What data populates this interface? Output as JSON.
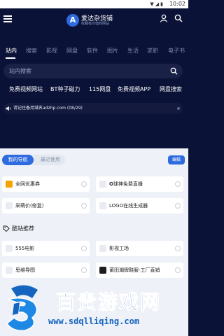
{
  "status_bar": {
    "time": "10:02",
    "signal_icon": "signal-icon",
    "battery_icon": "battery-icon"
  },
  "header": {
    "logo_letter": "A",
    "logo_name": "爱达杂货铺",
    "logo_subtitle": "收藏有价值的网站",
    "menu_icon": "menu-icon",
    "user_icon": "user-icon",
    "search_icon": "search-icon"
  },
  "tabs": [
    "站内",
    "搜索",
    "影视",
    "网盘",
    "软件",
    "图片",
    "生活",
    "求职",
    "电子书"
  ],
  "search": {
    "placeholder": "站内搜索"
  },
  "hot_links": [
    "免费视频网站",
    "BT种子磁力",
    "115网盘",
    "免费视频APP",
    "网盘搜索"
  ],
  "notice": {
    "text": "请记住备用域名adzhp.com (08/29)"
  },
  "nav": {
    "segment_active": "我的导航",
    "segment_inactive": "最近使用",
    "edit_label": "编辑",
    "items": [
      "全网优惠券",
      "✪球神免费直播",
      "采萌价(修复)",
      "LOGO在线生成器"
    ]
  },
  "cool_sites": {
    "title": "酷站推荐",
    "items": [
      "555电影",
      "影视工场",
      "思维导图",
      "莆田潮牌鞋服-工厂直销"
    ]
  },
  "watermark": {
    "title": "百贵游戏网",
    "url": "www.sdqlliqing.com"
  },
  "colors": {
    "dark_bg": "#0b1237",
    "accent": "#2e6bde",
    "panel_bg": "#eef1f7",
    "watermark_blue": "#1565c0"
  }
}
